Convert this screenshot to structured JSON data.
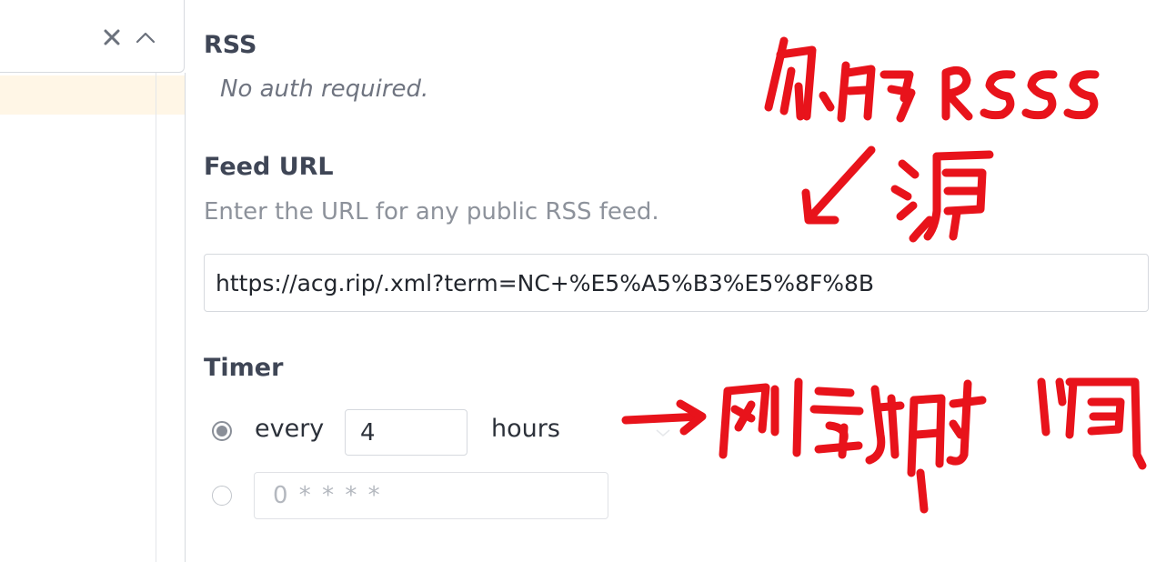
{
  "sidebar": {
    "close_icon": "close-icon",
    "collapse_icon": "chevron-up-icon",
    "selected_color": "#fff6e6"
  },
  "rss": {
    "title": "RSS",
    "subtitle": "No auth required."
  },
  "feed_url": {
    "title": "Feed URL",
    "description": "Enter the URL for any public RSS feed.",
    "value": "https://acg.rip/.xml?term=NC+%E5%A5%B3%E5%8F%8B"
  },
  "timer": {
    "title": "Timer",
    "every_label": "every",
    "interval_value": "4",
    "unit": "hours",
    "selected_option": "every",
    "cron_placeholder": "0 * * * *"
  },
  "annotations": {
    "color": "#e8131b"
  }
}
